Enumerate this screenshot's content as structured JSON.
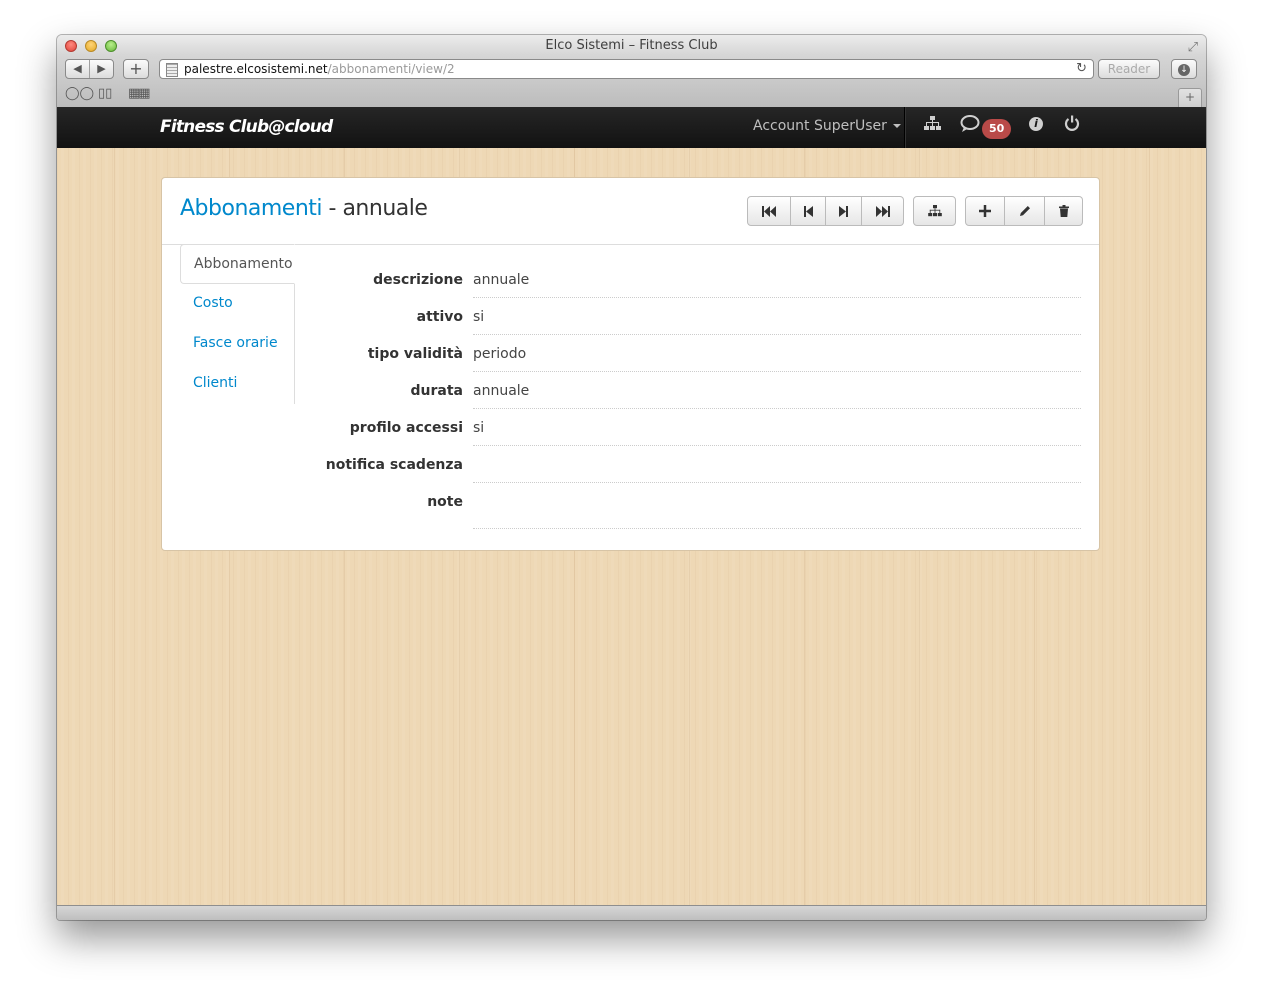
{
  "browser": {
    "window_title": "Elco Sistemi – Fitness Club",
    "url_host": "palestre.elcosistemi.net",
    "url_path": "/abbonamenti/view/2",
    "reader_label": "Reader"
  },
  "navbar": {
    "brand": "Fitness Club@cloud",
    "account_label": "Account SuperUser",
    "messages_badge": "50"
  },
  "page": {
    "breadcrumb": "Abbonamenti",
    "separator": " - ",
    "title": "annuale"
  },
  "icons": {
    "first": "first-record-icon",
    "prev": "previous-record-icon",
    "next": "next-record-icon",
    "last": "last-record-icon",
    "tree": "sitemap-icon",
    "add": "plus-icon",
    "edit": "pencil-icon",
    "delete": "trash-icon"
  },
  "tabs": [
    {
      "label": "Abbonamento",
      "active": true
    },
    {
      "label": "Costo"
    },
    {
      "label": "Fasce orarie"
    },
    {
      "label": "Clienti"
    }
  ],
  "fields": [
    {
      "label": "descrizione",
      "value": "annuale"
    },
    {
      "label": "attivo",
      "value": "si"
    },
    {
      "label": "tipo validità",
      "value": "periodo"
    },
    {
      "label": "durata",
      "value": "annuale"
    },
    {
      "label": "profilo accessi",
      "value": "si"
    },
    {
      "label": "notifica scadenza",
      "value": ""
    },
    {
      "label": "note",
      "value": ""
    }
  ],
  "colors": {
    "link": "#0088cc",
    "navbar": "#1b1b1b",
    "badge": "#b94a48",
    "wood": "#eed8b5"
  }
}
